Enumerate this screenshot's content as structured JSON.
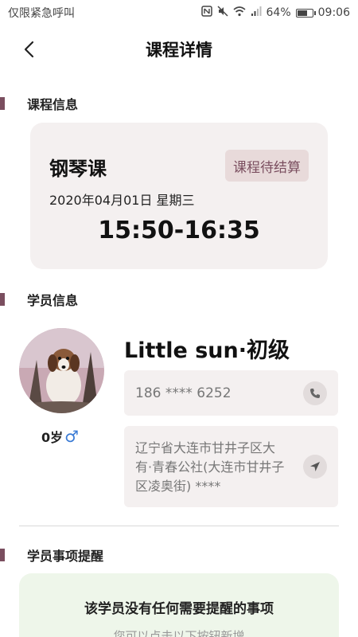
{
  "status_bar": {
    "carrier": "仅限紧急呼叫",
    "battery": "64%",
    "time": "09:06"
  },
  "nav": {
    "title": "课程详情"
  },
  "sections": {
    "course_info": "课程信息",
    "student_info": "学员信息",
    "student_reminder": "学员事项提醒"
  },
  "course": {
    "name": "钢琴课",
    "status": "课程待结算",
    "date": "2020年04月01日 星期三",
    "time": "15:50-16:35"
  },
  "student": {
    "name": "Little sun·初级",
    "age": "0岁",
    "gender_symbol": "♂",
    "phone": "186 **** 6252",
    "address": "辽宁省大连市甘井子区大有·青春公社(大连市甘井子区凌奥街) ****"
  },
  "reminder": {
    "title": "该学员没有任何需要提醒的事项",
    "subtitle": "您可以点击以下按钮新增"
  },
  "colors": {
    "accent": "#7a4e5f",
    "card_bg": "#f4f0f0",
    "reminder_bg": "#eef6ea",
    "male": "#3a7bd5"
  }
}
